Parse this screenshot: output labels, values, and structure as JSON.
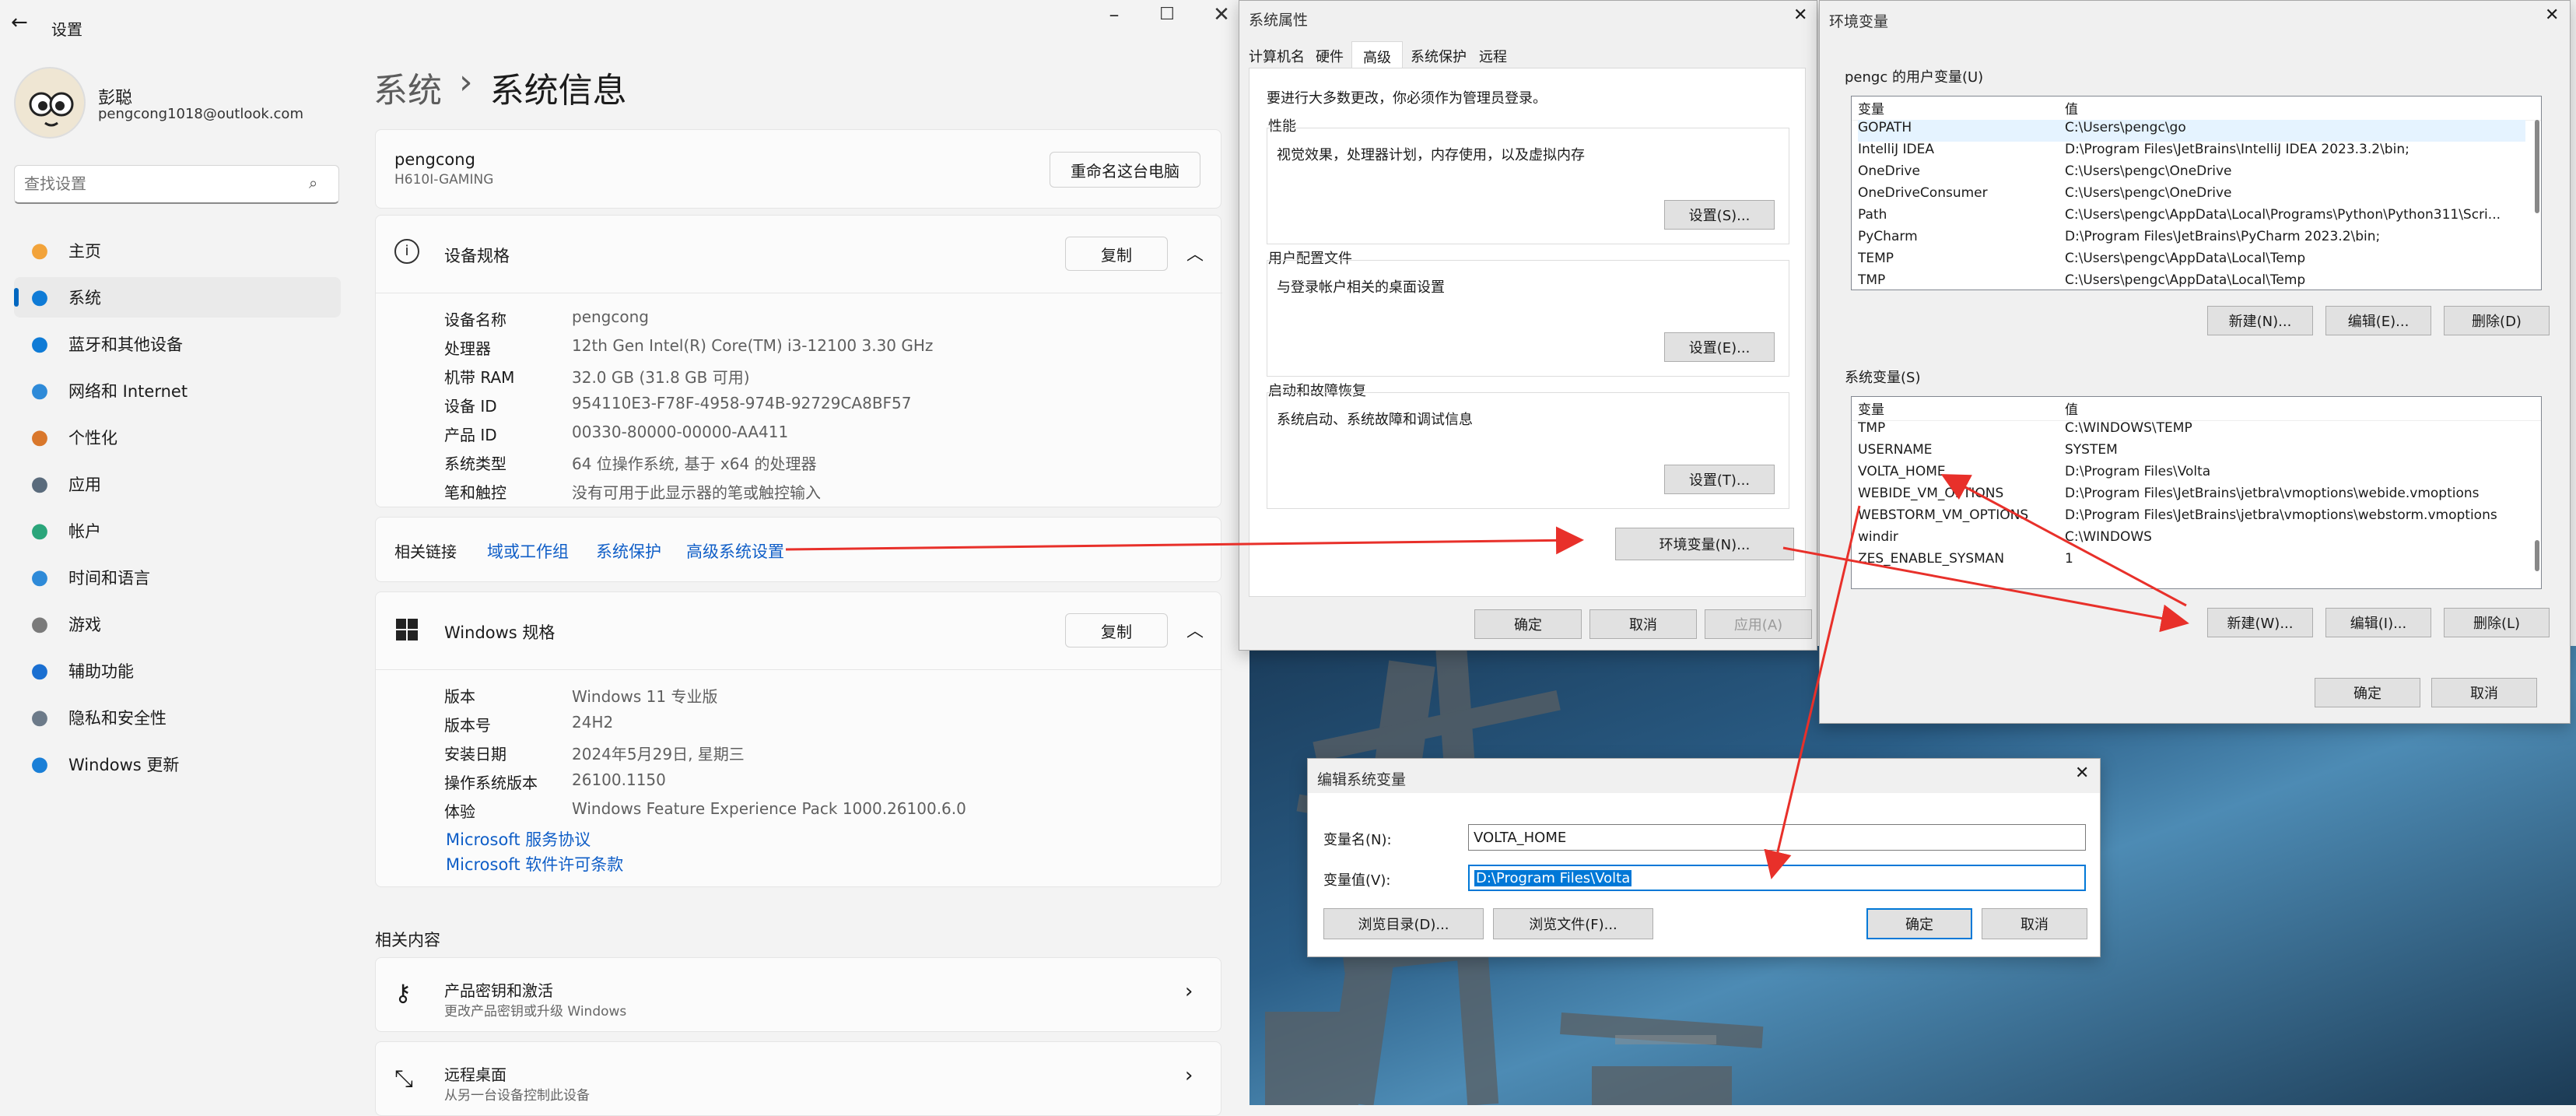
{
  "settings": {
    "window_title": "设置",
    "user": {
      "name": "彭聪",
      "email": "pengcong1018@outlook.com"
    },
    "search_placeholder": "查找设置",
    "nav": [
      {
        "label": "主页",
        "icon": "home-icon",
        "color": "#f2a33a"
      },
      {
        "label": "系统",
        "icon": "system-icon",
        "color": "#0f7bd6"
      },
      {
        "label": "蓝牙和其他设备",
        "icon": "bluetooth-icon",
        "color": "#0f7bd6"
      },
      {
        "label": "网络和 Internet",
        "icon": "wifi-icon",
        "color": "#2e8ad8"
      },
      {
        "label": "个性化",
        "icon": "brush-icon",
        "color": "#d9772b"
      },
      {
        "label": "应用",
        "icon": "apps-icon",
        "color": "#5a6b7c"
      },
      {
        "label": "帐户",
        "icon": "account-icon",
        "color": "#2aa57a"
      },
      {
        "label": "时间和语言",
        "icon": "globe-clock-icon",
        "color": "#2e8ad8"
      },
      {
        "label": "游戏",
        "icon": "gamepad-icon",
        "color": "#7a7a7a"
      },
      {
        "label": "辅助功能",
        "icon": "accessibility-icon",
        "color": "#1a6fd1"
      },
      {
        "label": "隐私和安全性",
        "icon": "shield-icon",
        "color": "#6c7a89"
      },
      {
        "label": "Windows 更新",
        "icon": "update-icon",
        "color": "#1a7fd7"
      }
    ],
    "breadcrumb": {
      "parent": "系统",
      "sep": "›",
      "current": "系统信息"
    },
    "pc": {
      "name": "pengcong",
      "model": "H610I-GAMING",
      "rename_button": "重命名这台电脑"
    },
    "device_specs": {
      "title": "设备规格",
      "copy_button": "复制",
      "rows": [
        {
          "label": "设备名称",
          "value": "pengcong"
        },
        {
          "label": "处理器",
          "value": "12th Gen Intel(R) Core(TM) i3-12100   3.30 GHz"
        },
        {
          "label": "机带 RAM",
          "value": "32.0 GB (31.8 GB 可用)"
        },
        {
          "label": "设备 ID",
          "value": "954110E3-F78F-4958-974B-92729CA8BF57"
        },
        {
          "label": "产品 ID",
          "value": "00330-80000-00000-AA411"
        },
        {
          "label": "系统类型",
          "value": "64 位操作系统, 基于 x64 的处理器"
        },
        {
          "label": "笔和触控",
          "value": "没有可用于此显示器的笔或触控输入"
        }
      ]
    },
    "related_links": {
      "label": "相关链接",
      "links": [
        "域或工作组",
        "系统保护",
        "高级系统设置"
      ]
    },
    "windows_specs": {
      "title": "Windows 规格",
      "copy_button": "复制",
      "rows": [
        {
          "label": "版本",
          "value": "Windows 11 专业版"
        },
        {
          "label": "版本号",
          "value": "24H2"
        },
        {
          "label": "安装日期",
          "value": "2024年5月29日, 星期三"
        },
        {
          "label": "操作系统版本",
          "value": "26100.1150"
        },
        {
          "label": "体验",
          "value": "Windows Feature Experience Pack 1000.26100.6.0"
        }
      ],
      "links": [
        "Microsoft 服务协议",
        "Microsoft 软件许可条款"
      ]
    },
    "related_content": {
      "title": "相关内容",
      "items": [
        {
          "title": "产品密钥和激活",
          "subtitle": "更改产品密钥或升级 Windows"
        },
        {
          "title": "远程桌面",
          "subtitle": "从另一台设备控制此设备"
        }
      ]
    }
  },
  "system_properties": {
    "title": "系统属性",
    "tabs": [
      "计算机名",
      "硬件",
      "高级",
      "系统保护",
      "远程"
    ],
    "active_tab": "高级",
    "admin_note": "要进行大多数更改，你必须作为管理员登录。",
    "groups": [
      {
        "label": "性能",
        "desc": "视觉效果，处理器计划，内存使用，以及虚拟内存",
        "button": "设置(S)..."
      },
      {
        "label": "用户配置文件",
        "desc": "与登录帐户相关的桌面设置",
        "button": "设置(E)..."
      },
      {
        "label": "启动和故障恢复",
        "desc": "系统启动、系统故障和调试信息",
        "button": "设置(T)..."
      }
    ],
    "env_button": "环境变量(N)...",
    "ok": "确定",
    "cancel": "取消",
    "apply": "应用(A)"
  },
  "env_vars": {
    "title": "环境变量",
    "user_section": "pengc 的用户变量(U)",
    "col_var": "变量",
    "col_val": "值",
    "user_vars": [
      {
        "name": "GOPATH",
        "value": "C:\\Users\\pengc\\go"
      },
      {
        "name": "IntelliJ IDEA",
        "value": "D:\\Program Files\\JetBrains\\IntelliJ IDEA 2023.3.2\\bin;"
      },
      {
        "name": "OneDrive",
        "value": "C:\\Users\\pengc\\OneDrive"
      },
      {
        "name": "OneDriveConsumer",
        "value": "C:\\Users\\pengc\\OneDrive"
      },
      {
        "name": "Path",
        "value": "C:\\Users\\pengc\\AppData\\Local\\Programs\\Python\\Python311\\Scri..."
      },
      {
        "name": "PyCharm",
        "value": "D:\\Program Files\\JetBrains\\PyCharm 2023.2\\bin;"
      },
      {
        "name": "TEMP",
        "value": "C:\\Users\\pengc\\AppData\\Local\\Temp"
      },
      {
        "name": "TMP",
        "value": "C:\\Users\\pengc\\AppData\\Local\\Temp"
      }
    ],
    "user_buttons": [
      "新建(N)...",
      "编辑(E)...",
      "删除(D)"
    ],
    "sys_section": "系统变量(S)",
    "sys_vars": [
      {
        "name": "TMP",
        "value": "C:\\WINDOWS\\TEMP"
      },
      {
        "name": "USERNAME",
        "value": "SYSTEM"
      },
      {
        "name": "VOLTA_HOME",
        "value": "D:\\Program Files\\Volta"
      },
      {
        "name": "WEBIDE_VM_OPTIONS",
        "value": "D:\\Program Files\\JetBrains\\jetbra\\vmoptions\\webide.vmoptions"
      },
      {
        "name": "WEBSTORM_VM_OPTIONS",
        "value": "D:\\Program Files\\JetBrains\\jetbra\\vmoptions\\webstorm.vmoptions"
      },
      {
        "name": "windir",
        "value": "C:\\WINDOWS"
      },
      {
        "name": "ZES_ENABLE_SYSMAN",
        "value": "1"
      }
    ],
    "sys_buttons": [
      "新建(W)...",
      "编辑(I)...",
      "删除(L)"
    ],
    "ok": "确定",
    "cancel": "取消"
  },
  "edit_var": {
    "title": "编辑系统变量",
    "name_label": "变量名(N):",
    "name_value": "VOLTA_HOME",
    "value_label": "变量值(V):",
    "value_value": "D:\\Program Files\\Volta",
    "browse_dir": "浏览目录(D)...",
    "browse_file": "浏览文件(F)...",
    "ok": "确定",
    "cancel": "取消"
  },
  "annotation_color": "#e8302a"
}
